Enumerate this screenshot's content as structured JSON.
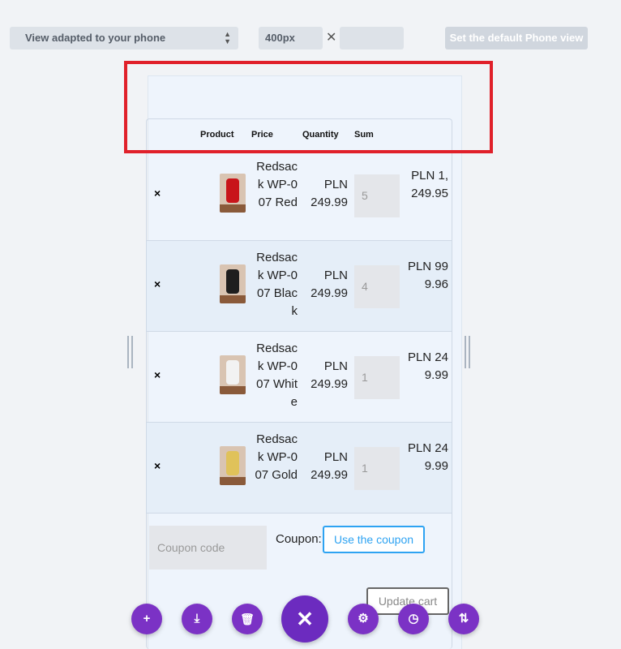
{
  "toolbar": {
    "view_select_value": "View adapted to your phone",
    "width_value": "400px",
    "default_button_label": "Set the default Phone view"
  },
  "cart": {
    "headers": {
      "product": "Product",
      "price": "Price",
      "quantity": "Quantity",
      "sum": "Sum"
    },
    "rows": [
      {
        "name": "Redsack WP-007 Red",
        "price": "PLN 249.99",
        "qty": "5",
        "sum": "PLN 1,249.95",
        "color": "#c8141a"
      },
      {
        "name": "Redsack WP-007 Black",
        "price": "PLN 249.99",
        "qty": "4",
        "sum": "PLN 999.96",
        "color": "#1e1e1e"
      },
      {
        "name": "Redsack WP-007 White",
        "price": "PLN 249.99",
        "qty": "1",
        "sum": "PLN 249.99",
        "color": "#f2f2f2"
      },
      {
        "name": "Redsack WP-007 Gold",
        "price": "PLN 249.99",
        "qty": "1",
        "sum": "PLN 249.99",
        "color": "#e0c25a"
      }
    ],
    "coupon_placeholder": "Coupon code",
    "coupon_label": "Coupon:",
    "coupon_button": "Use the coupon",
    "update_button": "Update cart"
  },
  "icons": {
    "remove": "×",
    "times": "✕",
    "select_arrows": "⇕"
  },
  "fab": {
    "add": "+",
    "download": "⤓",
    "trash": "🗑",
    "close": "✕",
    "settings": "⚙",
    "history": "◷",
    "sort": "⇅"
  },
  "colors": {
    "accent": "#7b32c5",
    "highlight": "#e0202a",
    "link": "#2ea3f2"
  }
}
